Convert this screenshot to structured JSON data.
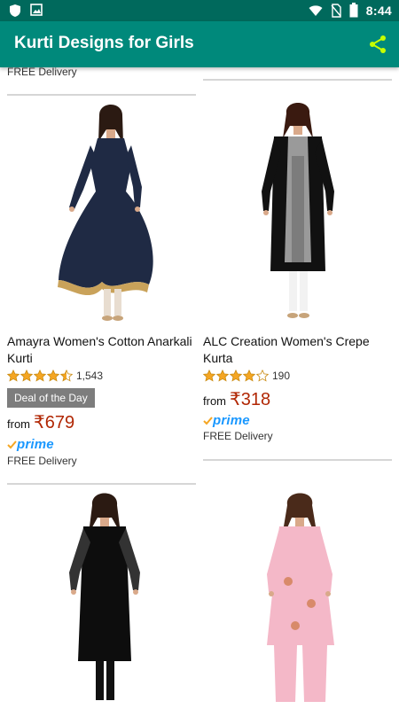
{
  "status_bar": {
    "time": "8:44"
  },
  "app_bar": {
    "title": "Kurti Designs for Girls"
  },
  "top_remnant": {
    "delivery": "FREE Delivery"
  },
  "products": [
    {
      "title": "Amayra Women's Cotton Anarkali Kurti",
      "rating": 4.5,
      "reviews": "1,543",
      "badge": "Deal of the Day",
      "price_prefix": "from",
      "currency": "₹",
      "price": "679",
      "prime": "prime",
      "delivery": "FREE Delivery",
      "colors": {
        "dress": "#1f2a44",
        "accent": "#c9a25a"
      }
    },
    {
      "title": "ALC Creation Women's Crepe Kurta",
      "rating": 4,
      "reviews": "190",
      "price_prefix": "from",
      "currency": "₹",
      "price": "318",
      "prime": "prime",
      "delivery": "FREE Delivery",
      "colors": {
        "dress": "#111111",
        "accent": "#9a9a9a"
      }
    },
    {
      "colors": {
        "dress": "#0d0d0d",
        "accent": "#333333"
      }
    },
    {
      "colors": {
        "dress": "#f4b8c8",
        "accent": "#d88a6a"
      }
    }
  ],
  "theme": {
    "status_bar": "#00695c",
    "app_bar": "#00897b",
    "share_icon": "#c6ff00",
    "price": "#b12704",
    "prime": "#1a98ff",
    "star": "#f5a623"
  }
}
